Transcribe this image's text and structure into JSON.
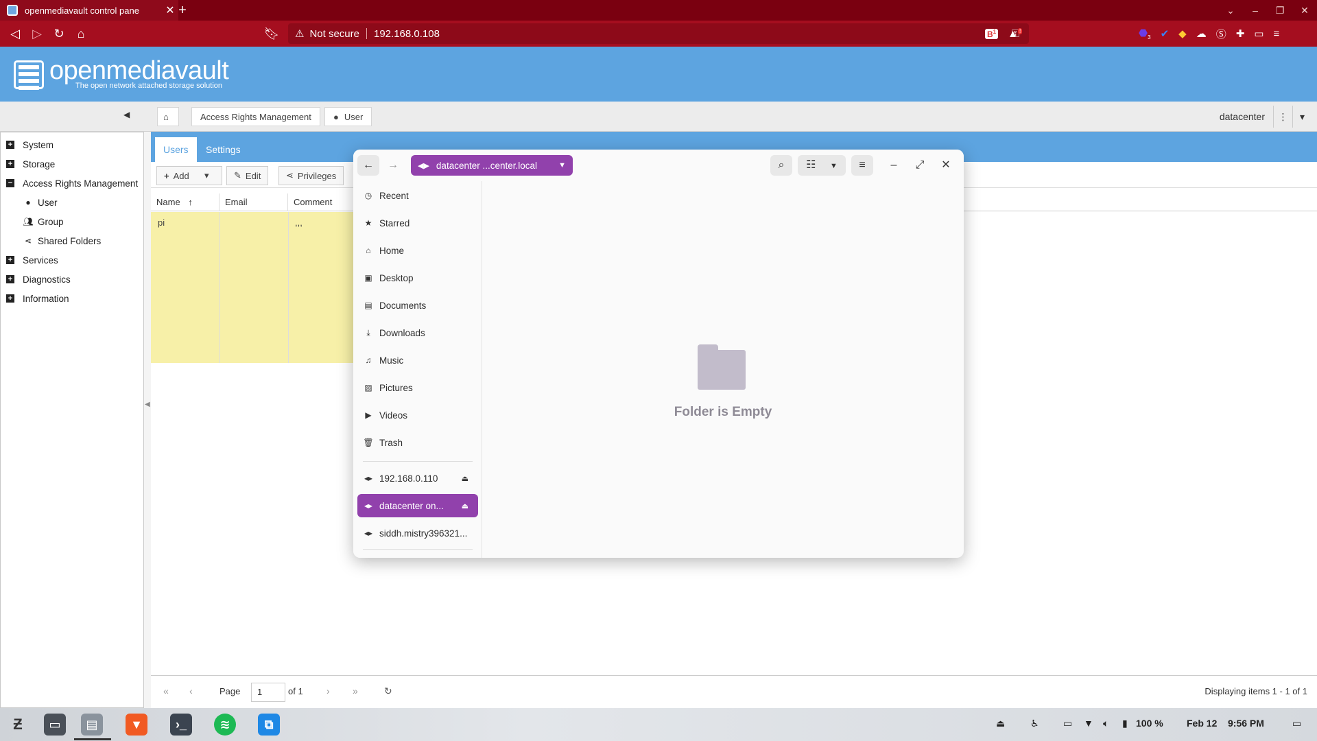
{
  "browser": {
    "tab_title": "openmediavault control pane",
    "new_tab": "+",
    "security": "Not secure",
    "url": "192.168.0.108",
    "brave_badge": "1",
    "alert_badge": "!",
    "ext_badge": "3"
  },
  "omv": {
    "title": "openmediavault",
    "subtitle": "The open network attached storage solution"
  },
  "breadcrumb": {
    "section": "Access Rights Management",
    "page": "User",
    "hostname": "datacenter"
  },
  "sidebar": {
    "items": [
      {
        "label": "System",
        "expand": "+"
      },
      {
        "label": "Storage",
        "expand": "+"
      },
      {
        "label": "Access Rights Management",
        "expand": "−"
      },
      {
        "label": "User"
      },
      {
        "label": "Group"
      },
      {
        "label": "Shared Folders"
      },
      {
        "label": "Services",
        "expand": "+"
      },
      {
        "label": "Diagnostics",
        "expand": "+"
      },
      {
        "label": "Information",
        "expand": "+"
      }
    ]
  },
  "main": {
    "tabs": [
      "Users",
      "Settings"
    ],
    "buttons": {
      "add": "Add",
      "edit": "Edit",
      "privileges": "Privileges"
    },
    "columns": [
      "Name",
      "Email",
      "Comment"
    ],
    "rows": [
      {
        "name": "pi",
        "email": "",
        "comment": ",,,"
      }
    ],
    "pager": {
      "page_label": "Page",
      "page_value": "1",
      "of_label": "of 1",
      "displaying": "Displaying items 1 - 1 of 1"
    }
  },
  "filemanager": {
    "path": "datacenter ...center.local",
    "places": [
      "Recent",
      "Starred",
      "Home",
      "Desktop",
      "Documents",
      "Downloads",
      "Music",
      "Pictures",
      "Videos",
      "Trash"
    ],
    "network": [
      "192.168.0.110",
      "datacenter on...",
      "siddh.mistry396321..."
    ],
    "empty_text": "Folder is Empty"
  },
  "taskbar": {
    "battery": "100 %",
    "date": "Feb 12",
    "time": "9:56 PM"
  },
  "colors": {
    "browser_tab": "#7a0010",
    "browser_toolbar": "#a50e1f",
    "omv_blue": "#5da4e0",
    "selection_purple": "#9141ac",
    "row_highlight": "#f7f0a8"
  }
}
